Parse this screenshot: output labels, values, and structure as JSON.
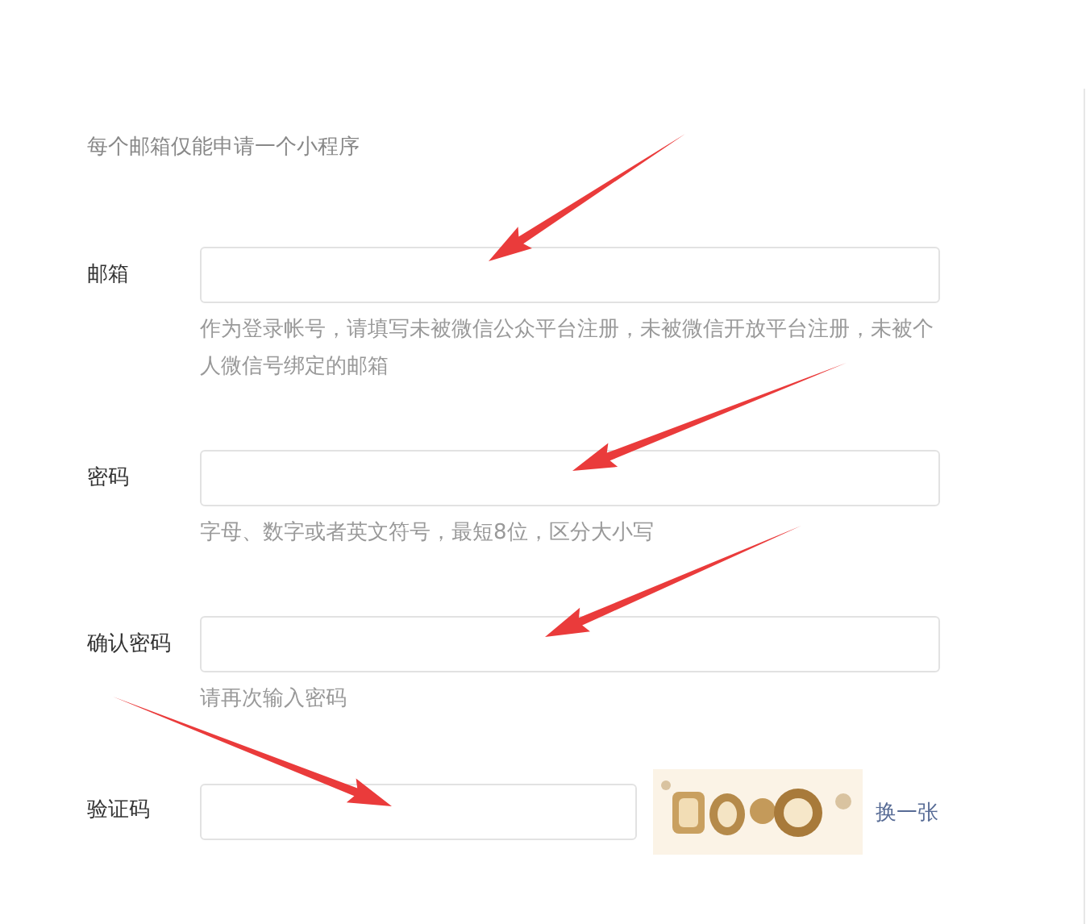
{
  "intro": "每个邮箱仅能申请一个小程序",
  "fields": [
    {
      "kind": "text",
      "label": "邮箱",
      "hint": "作为登录帐号，请填写未被微信公众平台注册，未被微信开放平台注册，未被个人微信号绑定的邮箱"
    },
    {
      "kind": "text",
      "label": "密码",
      "hint": "字母、数字或者英文符号，最短8位，区分大小写"
    },
    {
      "kind": "text",
      "label": "确认密码",
      "hint": "请再次输入密码"
    },
    {
      "kind": "captcha",
      "label": "验证码",
      "link": "换一张"
    }
  ]
}
